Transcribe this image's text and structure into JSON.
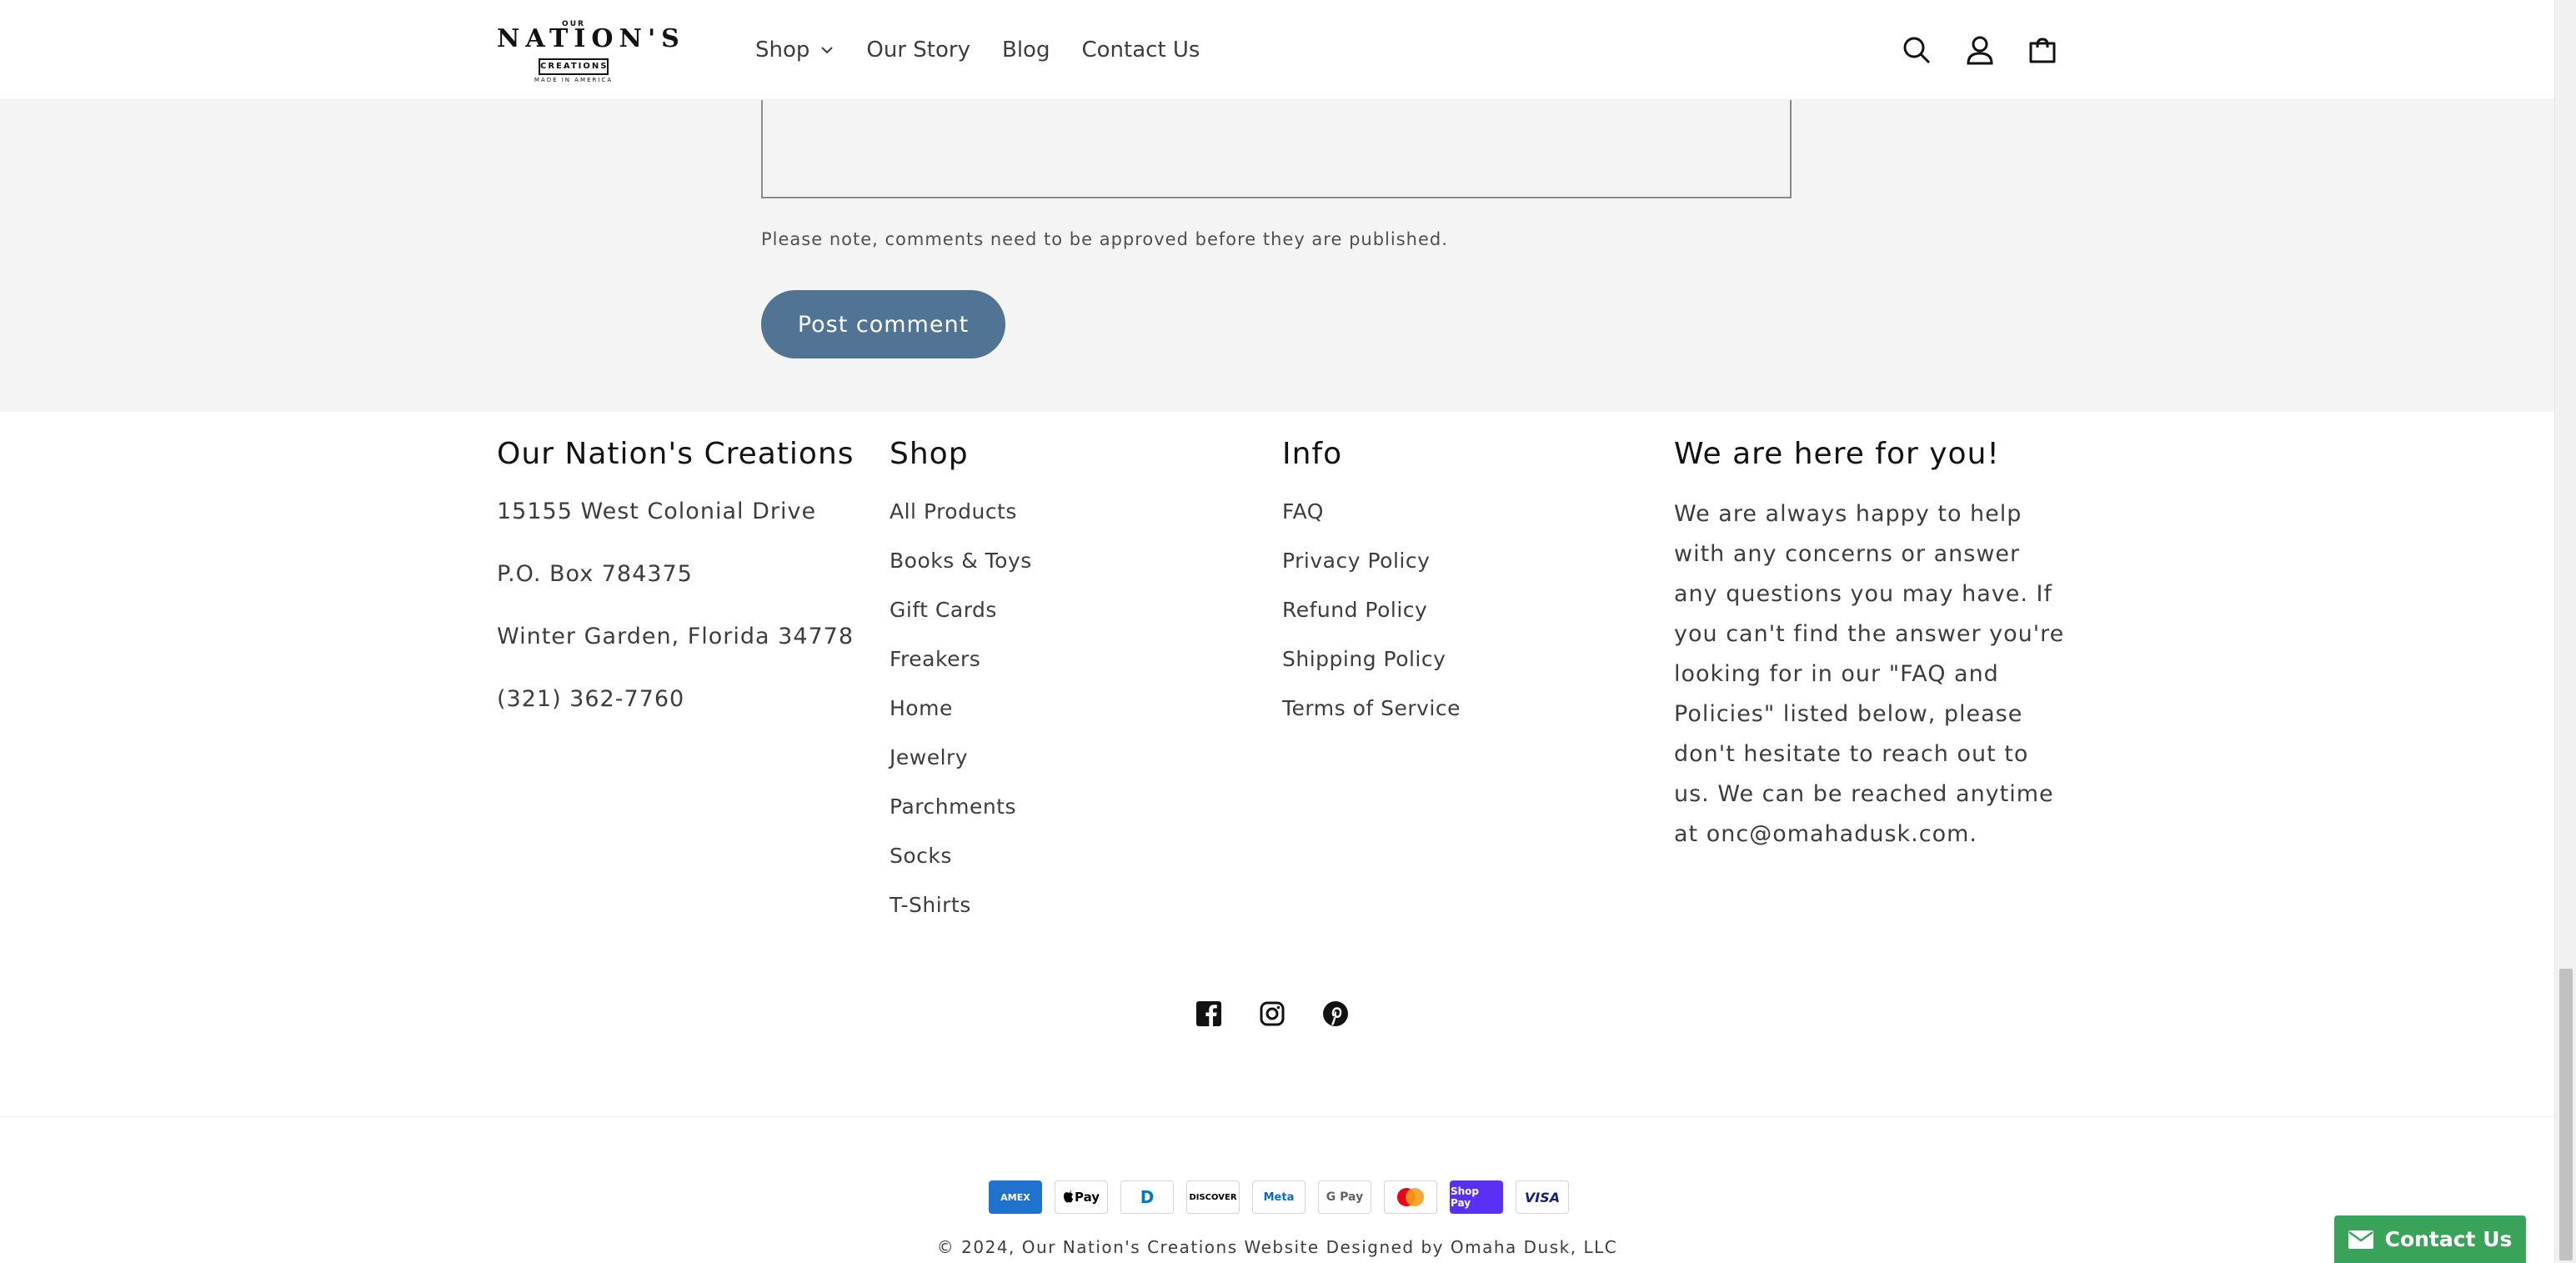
{
  "header": {
    "logo": {
      "top": "OUR",
      "main": "NATION'S",
      "boxed": "CREATIONS",
      "tagline": "MADE IN AMERICA"
    },
    "nav": [
      {
        "label": "Shop",
        "has_dropdown": true
      },
      {
        "label": "Our Story"
      },
      {
        "label": "Blog"
      },
      {
        "label": "Contact Us"
      }
    ],
    "icons": [
      "search-icon",
      "account-icon",
      "cart-icon"
    ]
  },
  "comment_form": {
    "note": "Please note, comments need to be approved before they are published.",
    "submit_label": "Post comment"
  },
  "footer": {
    "company": {
      "heading": "Our Nation's Creations",
      "address": [
        "15155 West Colonial Drive",
        "P.O. Box 784375",
        "Winter Garden, Florida 34778",
        "(321) 362-7760"
      ]
    },
    "shop": {
      "heading": "Shop",
      "links": [
        "All Products",
        "Books & Toys",
        "Gift Cards",
        "Freakers",
        "Home",
        "Jewelry",
        "Parchments",
        "Socks",
        "T-Shirts"
      ]
    },
    "info": {
      "heading": "Info",
      "links": [
        "FAQ",
        "Privacy Policy",
        "Refund Policy",
        "Shipping Policy",
        "Terms of Service"
      ]
    },
    "support": {
      "heading": "We are here for you!",
      "text": "We are always happy to help with any concerns or answer any questions you may have. If you can't find the answer you're looking for in our \"FAQ and Policies\" listed below, please don't hesitate to reach out to us. We can be reached anytime at onc@omahadusk.com."
    },
    "social": [
      "facebook-icon",
      "instagram-icon",
      "pinterest-icon"
    ],
    "payments": [
      {
        "name": "American Express",
        "label": "AMEX"
      },
      {
        "name": "Apple Pay",
        "label": "Pay"
      },
      {
        "name": "Diners Club",
        "label": "D"
      },
      {
        "name": "Discover",
        "label": "DISCOVER"
      },
      {
        "name": "Meta Pay",
        "label": "Meta"
      },
      {
        "name": "Google Pay",
        "label": "G Pay"
      },
      {
        "name": "Mastercard",
        "label": ""
      },
      {
        "name": "Shop Pay",
        "label": "Shop Pay"
      },
      {
        "name": "Visa",
        "label": "VISA"
      }
    ],
    "copyright": {
      "prefix": "© 2024, ",
      "site_link": "Our Nation's Creations Website",
      "middle": " Designed by ",
      "designer_link": "Omaha Dusk, LLC"
    }
  },
  "contact_widget": {
    "label": "Contact Us"
  },
  "colors": {
    "button": "#517394",
    "band": "#f4f4f4",
    "contact_widget": "#3aa35a"
  }
}
